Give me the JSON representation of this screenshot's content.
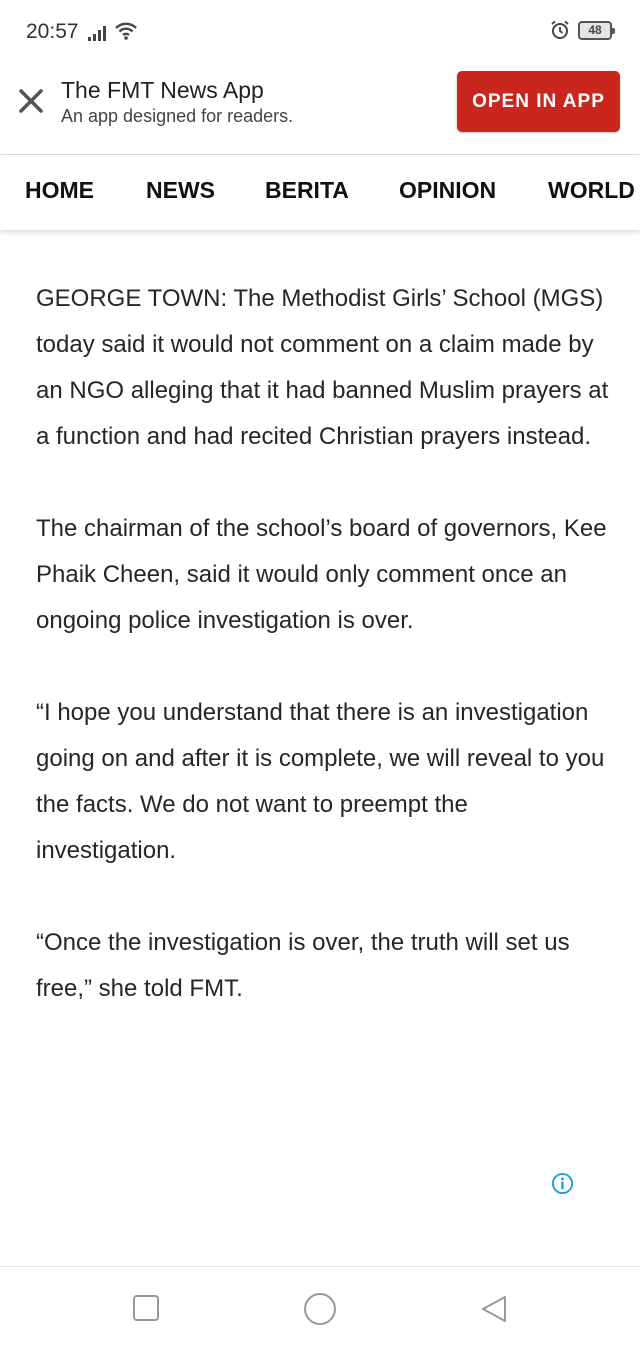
{
  "status_bar": {
    "time": "20:57",
    "battery": "48",
    "icons": [
      "signal-icon",
      "wifi-icon",
      "alarm-icon",
      "battery-icon"
    ]
  },
  "app_banner": {
    "title": "The FMT News App",
    "subtitle": "An app designed for readers.",
    "cta_label": "OPEN IN APP",
    "cta_color": "#c9271d"
  },
  "nav": {
    "items": [
      "HOME",
      "NEWS",
      "BERITA",
      "OPINION",
      "WORLD"
    ]
  },
  "article": {
    "paragraphs": [
      "GEORGE TOWN: The Methodist Girls’ School (MGS) today said it would not comment on a claim made by an NGO alleging that it had banned Muslim prayers at a function and had recited Christian prayers instead.",
      "The chairman of the school’s board of governors, Kee Phaik Cheen, said it would only comment once an ongoing police investigation is over.",
      "“I hope you understand that there is an investigation going on and after it is complete, we will reveal to you the facts. We do not want to preempt the investigation.",
      "“Once the investigation is over, the truth will set us free,” she told FMT."
    ]
  },
  "ad": {
    "icon": "info-icon",
    "icon_color": "#1aa3d9"
  },
  "system_nav": {
    "buttons": [
      "recents-button",
      "home-button",
      "back-button"
    ]
  }
}
